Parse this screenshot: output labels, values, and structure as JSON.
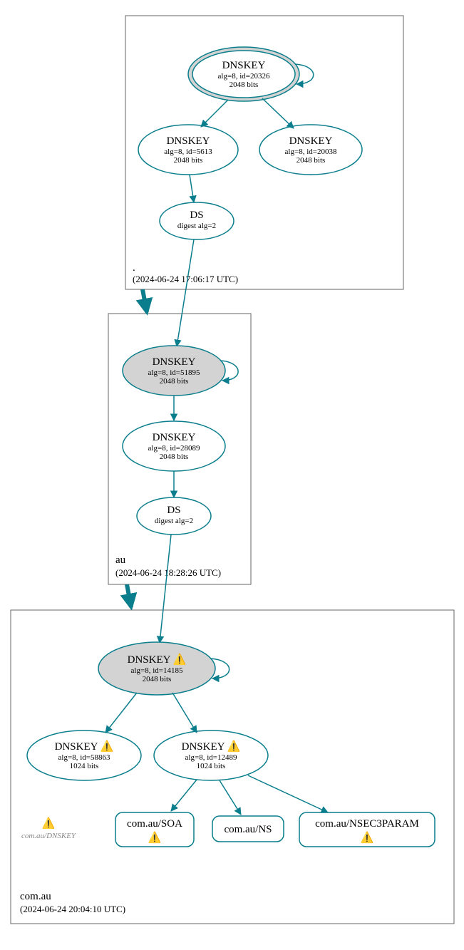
{
  "zones": {
    "root": {
      "label": ".",
      "time": "(2024-06-24 17:06:17 UTC)"
    },
    "au": {
      "label": "au",
      "time": "(2024-06-24 18:28:26 UTC)"
    },
    "comau": {
      "label": "com.au",
      "time": "(2024-06-24 20:04:10 UTC)"
    }
  },
  "nodes": {
    "root_ksk": {
      "title": "DNSKEY",
      "l1": "alg=8, id=20326",
      "l2": "2048 bits"
    },
    "root_zsk1": {
      "title": "DNSKEY",
      "l1": "alg=8, id=5613",
      "l2": "2048 bits"
    },
    "root_zsk2": {
      "title": "DNSKEY",
      "l1": "alg=8, id=20038",
      "l2": "2048 bits"
    },
    "root_ds": {
      "title": "DS",
      "l1": "digest alg=2"
    },
    "au_ksk": {
      "title": "DNSKEY",
      "l1": "alg=8, id=51895",
      "l2": "2048 bits"
    },
    "au_zsk": {
      "title": "DNSKEY",
      "l1": "alg=8, id=28089",
      "l2": "2048 bits"
    },
    "au_ds": {
      "title": "DS",
      "l1": "digest alg=2"
    },
    "comau_ksk": {
      "title": "DNSKEY ⚠️",
      "l1": "alg=8, id=14185",
      "l2": "2048 bits"
    },
    "comau_zsk1": {
      "title": "DNSKEY ⚠️",
      "l1": "alg=8, id=58863",
      "l2": "1024 bits"
    },
    "comau_zsk2": {
      "title": "DNSKEY ⚠️",
      "l1": "alg=8, id=12489",
      "l2": "1024 bits"
    },
    "comau_soa": {
      "title": "com.au/SOA",
      "warn": "⚠️"
    },
    "comau_ns": {
      "title": "com.au/NS"
    },
    "comau_nsec3": {
      "title": "com.au/NSEC3PARAM",
      "warn": "⚠️"
    },
    "ghost": {
      "text": "com.au/DNSKEY",
      "warn": "⚠️"
    }
  }
}
